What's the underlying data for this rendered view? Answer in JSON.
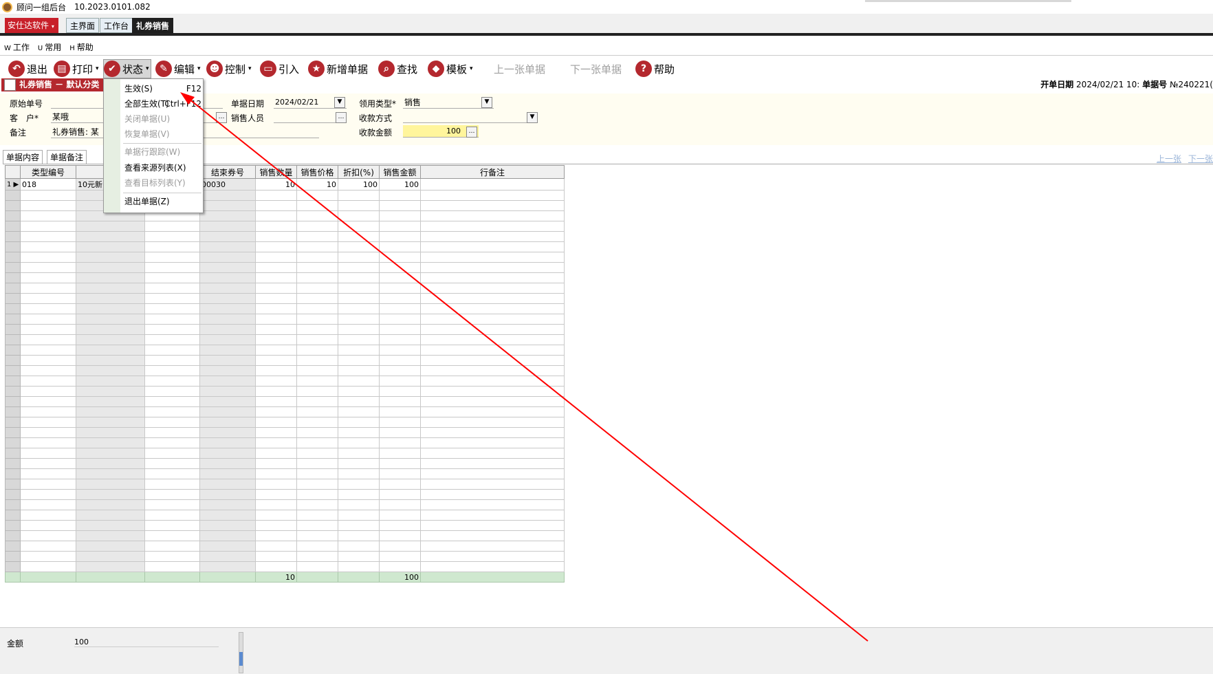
{
  "window": {
    "title": "顾问一组后台",
    "version": "10.2023.0101.082"
  },
  "tabbar": {
    "brand": "安仕达软件",
    "tabs": [
      "主界面",
      "工作台",
      "礼券销售"
    ]
  },
  "menubar": [
    {
      "key": "W",
      "label": "工作"
    },
    {
      "key": "U",
      "label": "常用"
    },
    {
      "key": "H",
      "label": "帮助"
    }
  ],
  "toolbar": {
    "exit": "退出",
    "print": "打印",
    "status": "状态",
    "edit": "编辑",
    "control": "控制",
    "import": "引入",
    "new_doc": "新增单据",
    "find": "查找",
    "template": "模板",
    "prev_doc": "上一张单据",
    "next_doc": "下一张单据",
    "help": "帮助"
  },
  "doc": {
    "title": "礼券销售 － 默认分类",
    "open_date_label": "开单日期",
    "open_date_value": "2024/02/21 10:",
    "doc_no_label": "单据号",
    "doc_no_value": "№240221("
  },
  "form": {
    "orig_no_label": "原始单号",
    "customer_label": "客　户*",
    "customer_value": "某哦",
    "remark_label": "备注",
    "remark_value": "礼券销售: 某",
    "date_label": "单据日期",
    "date_value": "2024/02/21",
    "sales_label": "销售人员",
    "usage_label": "领用类型*",
    "usage_value": "销售",
    "pay_method_label": "收款方式",
    "pay_amount_label": "收款金额",
    "pay_amount_value": "100"
  },
  "subtabs": {
    "tab1": "单据内容",
    "tab2": "单据备注",
    "prev": "上一张",
    "next": "下一张"
  },
  "grid": {
    "columns": [
      "类型编号",
      "类",
      "",
      "结束券号",
      "销售数量",
      "销售价格",
      "折扣(%)",
      "销售金额",
      "行备注"
    ],
    "row1": {
      "index": "1",
      "type_code": "018",
      "type_name": "10元新",
      "end_no": "00030",
      "qty": "10",
      "price": "10",
      "discount": "100",
      "amount": "100"
    },
    "totals": {
      "qty": "10",
      "amount": "100"
    }
  },
  "footer": {
    "amount_label": "金额",
    "amount_value": "100"
  },
  "status_menu": {
    "items": [
      {
        "label": "生效(S)",
        "shortcut": "F12"
      },
      {
        "label": "全部生效(T)",
        "shortcut": "Ctrl+F12"
      },
      {
        "label": "关闭单据(U)"
      },
      {
        "label": "恢复单据(V)"
      },
      {
        "label": "单据行跟踪(W)"
      },
      {
        "label": "查看来源列表(X)"
      },
      {
        "label": "查看目标列表(Y)"
      },
      {
        "label": "退出单据(Z)"
      }
    ]
  },
  "colors": {
    "accent": "#b4282e",
    "annotation": "#ff0000",
    "form_bg": "#fffdf1",
    "total_row": "#cfe8cf"
  }
}
